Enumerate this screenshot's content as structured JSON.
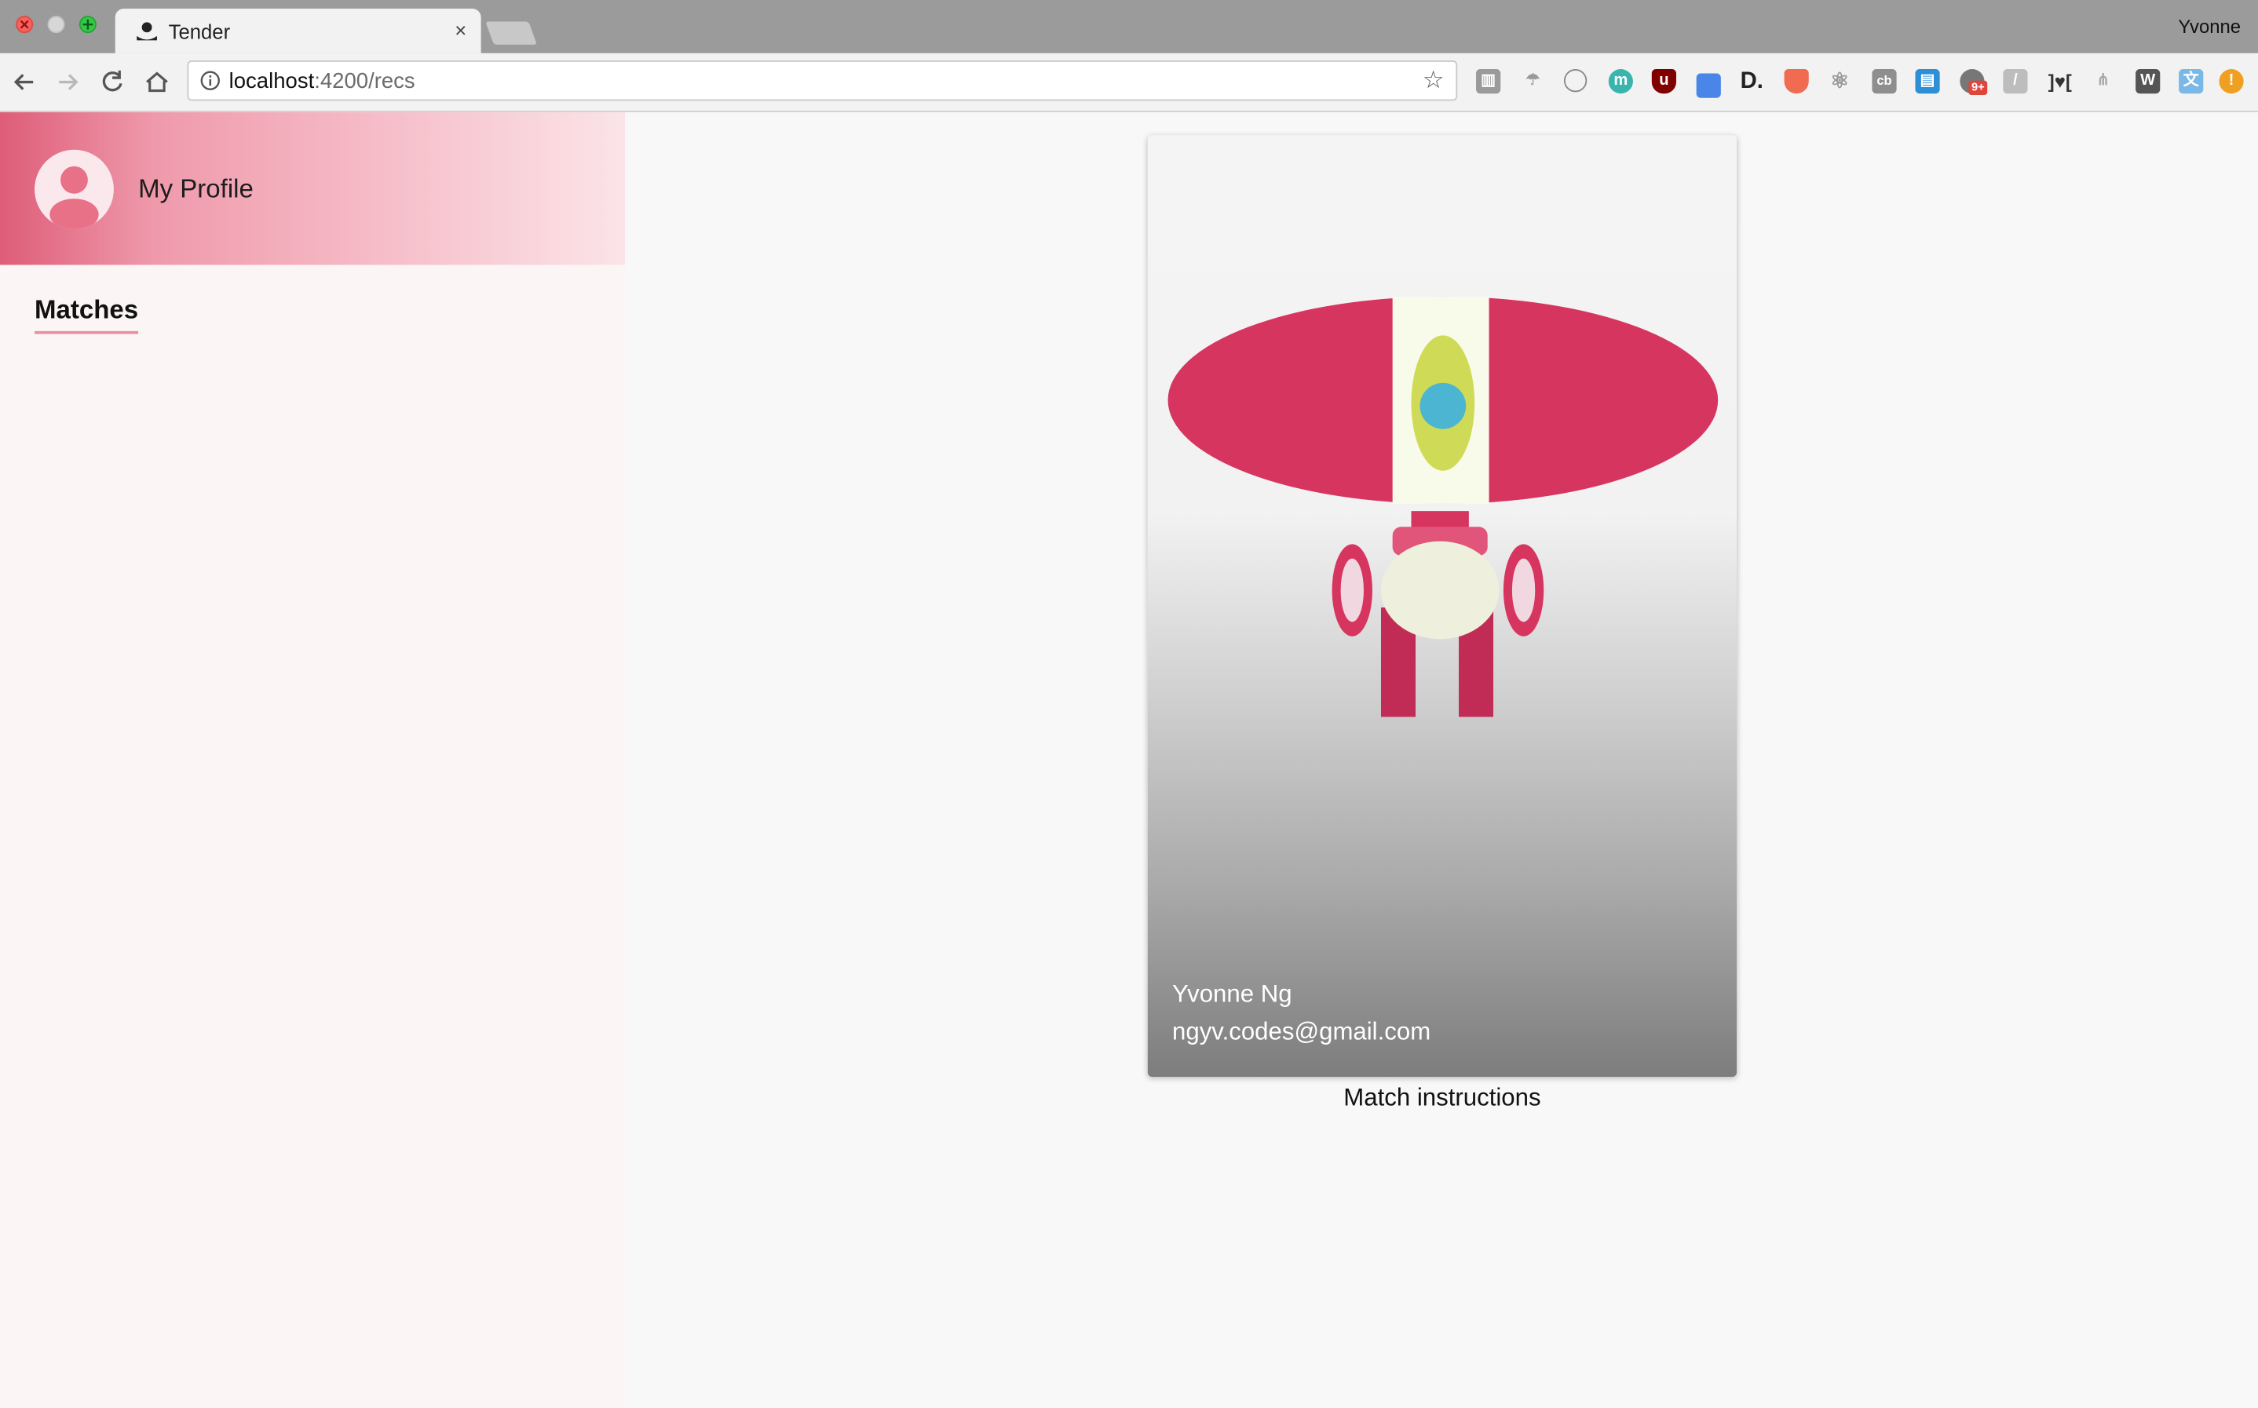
{
  "browser": {
    "tab_title": "Tender",
    "tab_close_glyph": "×",
    "profile_name": "Yvonne",
    "url_host": "localhost",
    "url_path": ":4200/recs",
    "bookmark_glyph": "☆",
    "extensions": [
      "library-icon",
      "cloud-icon",
      "clock-icon",
      "mercury-icon",
      "ublock-icon",
      "eyedropper-icon",
      "d-icon",
      "shield-icon",
      "react-icon",
      "cb-icon",
      "reader-icon",
      "notification-icon",
      "slash-icon",
      "bracket-heart-icon",
      "tree-icon",
      "w-icon",
      "translate-icon",
      "warning-icon"
    ],
    "notification_badge": "9+"
  },
  "sidebar": {
    "profile_label": "My Profile",
    "matches_heading": "Matches"
  },
  "card": {
    "name": "Yvonne Ng",
    "email": "ngyv.codes@gmail.com"
  },
  "match_instructions": "Match instructions",
  "colors": {
    "accent": "#d6355f",
    "banner_start": "#de5d78",
    "banner_end": "#fbe4e8"
  }
}
